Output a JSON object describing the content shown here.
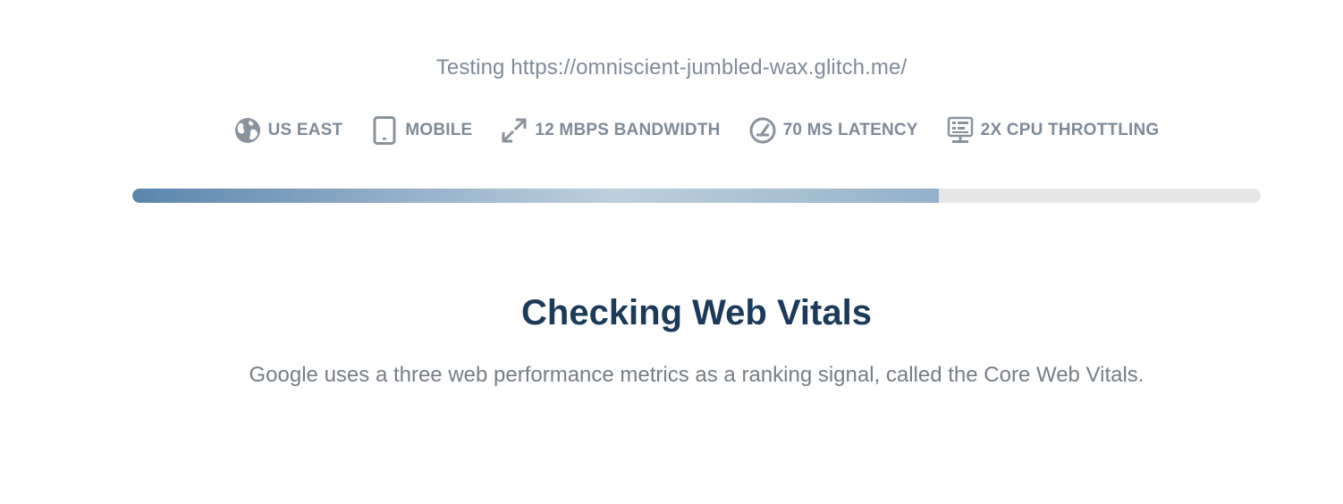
{
  "test": {
    "url_line": "Testing https://omniscient-jumbled-wax.glitch.me/"
  },
  "settings": [
    {
      "icon": "globe-icon",
      "label": "US EAST"
    },
    {
      "icon": "mobile-device-icon",
      "label": "MOBILE"
    },
    {
      "icon": "bandwidth-arrows-icon",
      "label": "12 MBPS BANDWIDTH"
    },
    {
      "icon": "latency-gauge-icon",
      "label": "70 MS LATENCY"
    },
    {
      "icon": "cpu-server-icon",
      "label": "2X CPU THROTTLING"
    }
  ],
  "progress": {
    "percent": 71.5
  },
  "status": {
    "heading": "Checking Web Vitals",
    "description": "Google uses a three web performance metrics as a ranking signal, called the Core Web Vitals."
  },
  "colors": {
    "muted_text": "#7f8a98",
    "heading": "#1c3b5a",
    "track": "#e6e6e6",
    "fill_start": "#5a86ad",
    "fill_mid": "#bcd0de"
  }
}
